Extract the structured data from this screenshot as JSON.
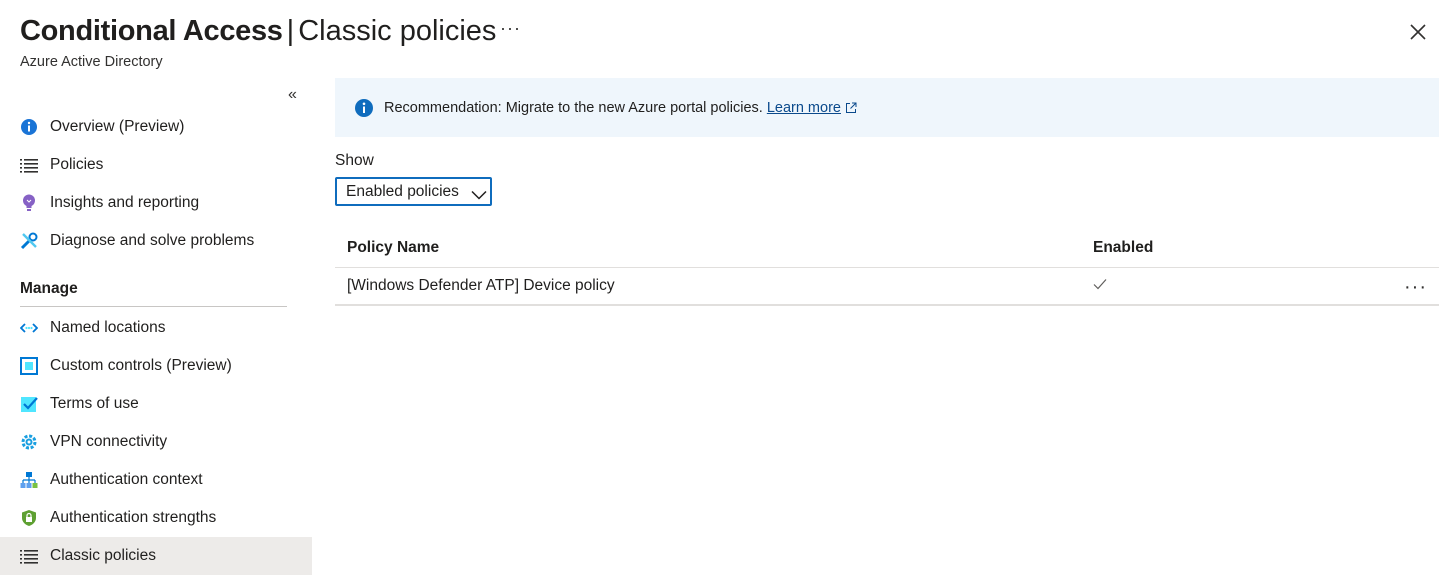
{
  "header": {
    "title_main": "Conditional Access",
    "title_sep": "|",
    "title_sub": "Classic policies",
    "more": "···",
    "subtitle": "Azure Active Directory"
  },
  "sidebar": {
    "collapse": "«",
    "items": [
      {
        "label": "Overview (Preview)",
        "icon": "info-icon"
      },
      {
        "label": "Policies",
        "icon": "list-icon"
      },
      {
        "label": "Insights and reporting",
        "icon": "lightbulb-icon"
      },
      {
        "label": "Diagnose and solve problems",
        "icon": "wrench-icon"
      }
    ],
    "manage_header": "Manage",
    "manage_items": [
      {
        "label": "Named locations",
        "icon": "network-icon"
      },
      {
        "label": "Custom controls (Preview)",
        "icon": "custom-controls-icon"
      },
      {
        "label": "Terms of use",
        "icon": "checklist-icon"
      },
      {
        "label": "VPN connectivity",
        "icon": "vpn-gear-icon"
      },
      {
        "label": "Authentication context",
        "icon": "hierarchy-icon"
      },
      {
        "label": "Authentication strengths",
        "icon": "shield-lock-icon"
      },
      {
        "label": "Classic policies",
        "icon": "list-icon",
        "selected": true
      }
    ]
  },
  "banner": {
    "text": "Recommendation: Migrate to the new Azure portal policies.",
    "link": "Learn more"
  },
  "filter": {
    "label": "Show",
    "value": "Enabled policies"
  },
  "table": {
    "columns": [
      "Policy Name",
      "Enabled"
    ],
    "rows": [
      {
        "name": "[Windows Defender ATP] Device policy",
        "enabled": true
      }
    ]
  },
  "colors": {
    "accent": "#0f6cbd",
    "banner_bg": "#eff6fc",
    "selected_bg": "#edebe9"
  }
}
